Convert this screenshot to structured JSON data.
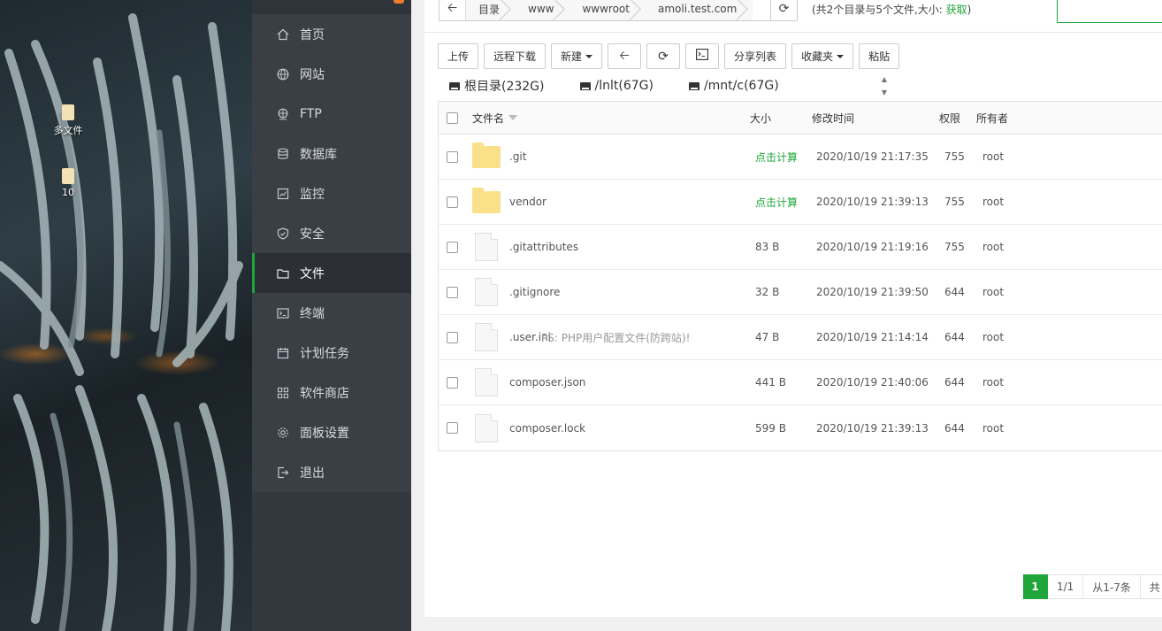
{
  "desktop": {
    "icons": [
      {
        "label": "多文件"
      },
      {
        "label": "10"
      }
    ]
  },
  "sidebar": {
    "items": [
      {
        "label": "首页",
        "icon": "home-icon"
      },
      {
        "label": "网站",
        "icon": "globe-icon"
      },
      {
        "label": "FTP",
        "icon": "ftp-globe-icon"
      },
      {
        "label": "数据库",
        "icon": "database-icon"
      },
      {
        "label": "监控",
        "icon": "monitor-chart-icon"
      },
      {
        "label": "安全",
        "icon": "shield-icon"
      },
      {
        "label": "文件",
        "icon": "folder-icon",
        "active": true
      },
      {
        "label": "终端",
        "icon": "terminal-icon"
      },
      {
        "label": "计划任务",
        "icon": "calendar-icon"
      },
      {
        "label": "软件商店",
        "icon": "grid-apps-icon"
      },
      {
        "label": "面板设置",
        "icon": "gear-icon"
      },
      {
        "label": "退出",
        "icon": "logout-icon"
      }
    ]
  },
  "path": {
    "crumbs": [
      "目录",
      "www",
      "wwwroot",
      "amoli.test.com"
    ],
    "info_prefix": "(共2个目录与5个文件,大小: ",
    "info_link": "获取",
    "info_suffix": ")"
  },
  "toolbar": {
    "upload": "上传",
    "remote_download": "远程下载",
    "new": "新建",
    "share_list": "分享列表",
    "favorites": "收藏夹",
    "paste": "粘贴"
  },
  "disks": [
    {
      "label": "根目录(232G)"
    },
    {
      "label": "/lnlt(67G)"
    },
    {
      "label": "/mnt/c(67G)"
    }
  ],
  "table": {
    "headers": {
      "name": "文件名",
      "size": "大小",
      "mtime": "修改时间",
      "perm": "权限",
      "owner": "所有者"
    },
    "rows": [
      {
        "type": "dir",
        "name": ".git",
        "size": "点击计算",
        "mtime": "2020/10/19 21:17:35",
        "perm": "755",
        "owner": "root",
        "note": ""
      },
      {
        "type": "dir",
        "name": "vendor",
        "size": "点击计算",
        "mtime": "2020/10/19 21:39:13",
        "perm": "755",
        "owner": "root",
        "note": ""
      },
      {
        "type": "file",
        "name": ".gitattributes",
        "size": "83 B",
        "mtime": "2020/10/19 21:19:16",
        "perm": "755",
        "owner": "root",
        "note": ""
      },
      {
        "type": "file",
        "name": ".gitignore",
        "size": "32 B",
        "mtime": "2020/10/19 21:39:50",
        "perm": "644",
        "owner": "root",
        "note": ""
      },
      {
        "type": "file",
        "name": ".user.ini",
        "size": "47 B",
        "mtime": "2020/10/19 21:14:14",
        "perm": "644",
        "owner": "root",
        "note": "PS: PHP用户配置文件(防跨站)!"
      },
      {
        "type": "file",
        "name": "composer.json",
        "size": "441 B",
        "mtime": "2020/10/19 21:40:06",
        "perm": "644",
        "owner": "root",
        "note": ""
      },
      {
        "type": "file",
        "name": "composer.lock",
        "size": "599 B",
        "mtime": "2020/10/19 21:39:13",
        "perm": "644",
        "owner": "root",
        "note": ""
      }
    ]
  },
  "pager": {
    "current": "1",
    "pages": "1/1",
    "range": "从1-7条",
    "total": "共"
  },
  "colors": {
    "accent": "#20a53a",
    "sidebar_bg": "#3a3f46",
    "sidebar_active": "#2c3036"
  }
}
